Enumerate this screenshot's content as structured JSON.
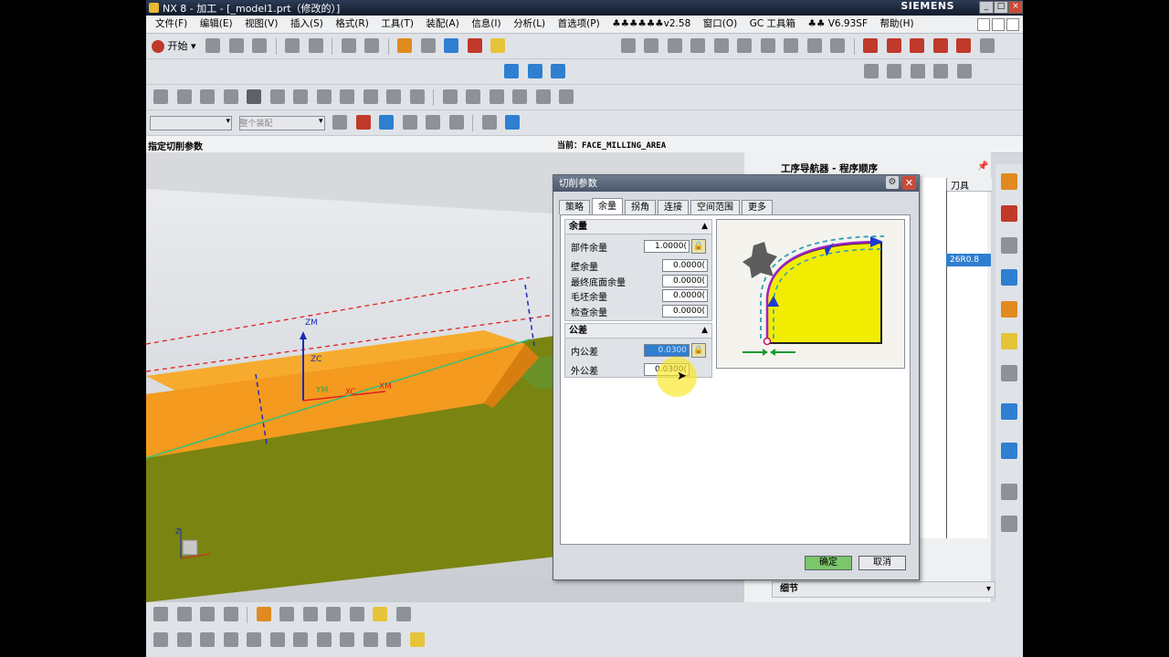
{
  "app": {
    "title": "NX 8 - 加工 - [_model1.prt（修改的）]",
    "brand": "SIEMENS"
  },
  "menu": {
    "items": [
      "文件(F)",
      "编辑(E)",
      "视图(V)",
      "插入(S)",
      "格式(R)",
      "工具(T)",
      "装配(A)",
      "信息(I)",
      "分析(L)",
      "首选项(P)",
      "♣♣♣♣♣♣v2.58",
      "窗口(O)",
      "GC 工具箱",
      "♣♣ V6.93SF",
      "帮助(H)"
    ]
  },
  "toolbar": {
    "start_label": "开始",
    "combo1": "",
    "combo2": "整个装配"
  },
  "status": {
    "prompt": "指定切削参数",
    "current": "当前：FACE_MILLING_AREA"
  },
  "navigator": {
    "title": "工序导航器 - 程序顺序",
    "col_tool": "刀具",
    "tool_value": "26R0.8",
    "detail": "细节"
  },
  "viewport": {
    "labels": [
      "ZM",
      "ZC",
      "XC",
      "XM",
      "YM",
      "Z"
    ]
  },
  "dialog": {
    "title": "切削参数",
    "tabs": [
      "策略",
      "余量",
      "拐角",
      "连接",
      "空间范围",
      "更多"
    ],
    "active_tab": "余量",
    "stock": {
      "header": "余量",
      "part_label": "部件余量",
      "part_value": "1.0000(",
      "wall_label": "壁余量",
      "wall_value": "0.0000(",
      "floor_label": "最终底面余量",
      "floor_value": "0.0000(",
      "blank_label": "毛坯余量",
      "blank_value": "0.0000(",
      "check_label": "检查余量",
      "check_value": "0.0000("
    },
    "tolerance": {
      "header": "公差",
      "intol_label": "内公差",
      "intol_value": "0.0300",
      "outtol_label": "外公差",
      "outtol_value": "0.0300("
    },
    "ok": "确定",
    "cancel": "取消"
  },
  "colors": {
    "part_orange": "#f39a1f",
    "floor_green": "#7a8410",
    "accent_blue": "#2f7fd1"
  }
}
